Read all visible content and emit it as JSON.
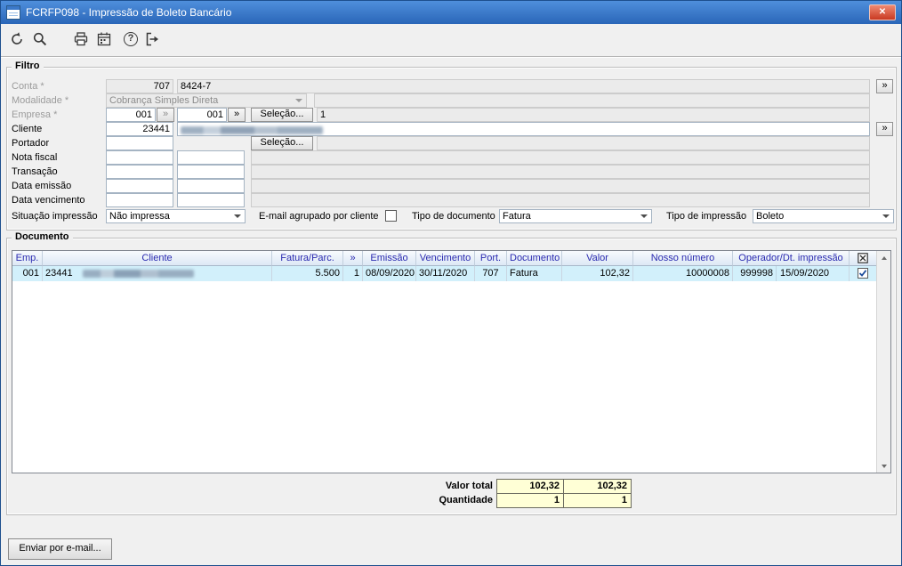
{
  "ui": {
    "more_label": "»",
    "selecao_label": "Seleção...",
    "help_glyph": "?",
    "close_glyph": "✕"
  },
  "window": {
    "title": "FCRFP098 - Impressão de Boleto Bancário"
  },
  "toolbar": {
    "icons": [
      "undo-icon",
      "search-icon",
      "print-icon",
      "calendar-icon",
      "help-icon",
      "exit-icon"
    ]
  },
  "filter": {
    "legend": "Filtro",
    "conta_label": "Conta *",
    "conta_code": "707",
    "conta_value": "8424-7",
    "modalidade_label": "Modalidade *",
    "modalidade_value": "Cobrança Simples Direta",
    "empresa_label": "Empresa *",
    "empresa_code1": "001",
    "empresa_code2": "001",
    "empresa_value": "1",
    "cliente_label": "Cliente",
    "cliente_code": "23441",
    "portador_label": "Portador",
    "nota_fiscal_label": "Nota fiscal",
    "transacao_label": "Transação",
    "data_emissao_label": "Data emissão",
    "data_vencimento_label": "Data vencimento",
    "situacao_label": "Situação impressão",
    "situacao_value": "Não impressa",
    "email_agrupado_label": "E-mail agrupado por cliente",
    "email_agrupado_checked": false,
    "tipo_documento_label": "Tipo de documento",
    "tipo_documento_value": "Fatura",
    "tipo_impressao_label": "Tipo de impressão",
    "tipo_impressao_value": "Boleto"
  },
  "documento": {
    "legend": "Documento",
    "grid": {
      "headers": [
        "Emp.",
        "Cliente",
        "Fatura/Parc.",
        "»",
        "Emissão",
        "Vencimento",
        "Port.",
        "Documento",
        "Valor",
        "Nosso número",
        "Operador/Dt. impressão"
      ],
      "rows": [
        {
          "emp": "001",
          "cliente_code": "23441",
          "fatura_parc": "5.500",
          "parc": "1",
          "emissao": "08/09/2020",
          "vencimento": "30/11/2020",
          "port": "707",
          "documento": "Fatura",
          "valor": "102,32",
          "nosso_numero": "10000008",
          "operador": "999998",
          "dt_impressao": "15/09/2020",
          "checked": true
        }
      ]
    },
    "totals": {
      "valor_label": "Valor total",
      "valor_a": "102,32",
      "valor_b": "102,32",
      "quantidade_label": "Quantidade",
      "quantidade_a": "1",
      "quantidade_b": "1"
    }
  },
  "footer": {
    "email_button_label": "Enviar por e-mail..."
  }
}
